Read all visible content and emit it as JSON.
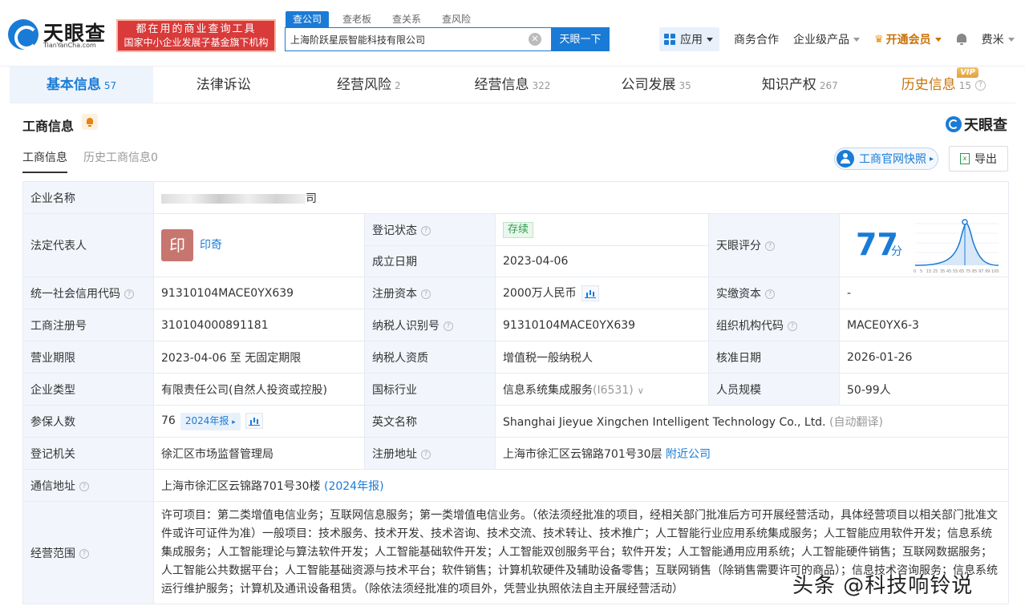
{
  "header": {
    "logo_name": "天眼查",
    "logo_sub": "TianYanCha.com",
    "promo_line1": "都在用的商业查询工具",
    "promo_line2": "国家中小企业发展子基金旗下机构",
    "search_tabs": [
      "查公司",
      "查老板",
      "查关系",
      "查风险"
    ],
    "search_value": "上海阶跃星辰智能科技有限公司",
    "search_button": "天眼一下",
    "nav": {
      "apps": "应用",
      "biz": "商务合作",
      "enterprise": "企业级产品",
      "vip": "开通会员",
      "user": "费米"
    }
  },
  "tabs": [
    {
      "label": "基本信息",
      "count": "57"
    },
    {
      "label": "法律诉讼",
      "count": ""
    },
    {
      "label": "经营风险",
      "count": "2"
    },
    {
      "label": "经营信息",
      "count": "322"
    },
    {
      "label": "公司发展",
      "count": "35"
    },
    {
      "label": "知识产权",
      "count": "267"
    },
    {
      "label": "历史信息",
      "count": "15"
    }
  ],
  "vip_badge": "VIP",
  "section": {
    "title": "工商信息",
    "logo": "天眼查",
    "sub_tabs": [
      "工商信息",
      "历史工商信息0"
    ],
    "snapshot": "工商官网快照",
    "export": "导出"
  },
  "info": {
    "company_name_label": "企业名称",
    "company_name_tail": "司",
    "legal_rep_label": "法定代表人",
    "legal_rep_avatar": "印",
    "legal_rep_name": "印奇",
    "reg_status_label": "登记状态",
    "reg_status": "存续",
    "founded_label": "成立日期",
    "founded": "2023-04-06",
    "score_label": "天眼评分",
    "score": "77",
    "score_unit": "分",
    "score_ticks": [
      "0",
      "5",
      "15",
      "25",
      "35",
      "45",
      "55",
      "65",
      "75",
      "85",
      "97",
      "99",
      "100"
    ],
    "credit_code_label": "统一社会信用代码",
    "credit_code": "91310104MACE0YX639",
    "reg_capital_label": "注册资本",
    "reg_capital": "2000万人民币",
    "paid_capital_label": "实缴资本",
    "paid_capital": "-",
    "reg_no_label": "工商注册号",
    "reg_no": "310104000891181",
    "taxpayer_id_label": "纳税人识别号",
    "taxpayer_id": "91310104MACE0YX639",
    "org_code_label": "组织机构代码",
    "org_code": "MACE0YX6-3",
    "term_label": "营业期限",
    "term": "2023-04-06 至 无固定期限",
    "taxpayer_qual_label": "纳税人资质",
    "taxpayer_qual": "增值税一般纳税人",
    "approve_label": "核准日期",
    "approve": "2026-01-26",
    "type_label": "企业类型",
    "type": "有限责任公司(自然人投资或控股)",
    "industry_label": "国标行业",
    "industry": "信息系统集成服务",
    "industry_code": "(I6531)",
    "staff_label": "人员规模",
    "staff": "50-99人",
    "insured_label": "参保人数",
    "insured": "76",
    "insured_report": "2024年报",
    "english_label": "英文名称",
    "english": "Shanghai Jieyue Xingchen Intelligent Technology Co., Ltd.",
    "english_note": "(自动翻译)",
    "authority_label": "登记机关",
    "authority": "徐汇区市场监督管理局",
    "reg_addr_label": "注册地址",
    "reg_addr": "上海市徐汇区云锦路701号30层",
    "nearby": "附近公司",
    "mail_label": "通信地址",
    "mail_addr": "上海市徐汇区云锦路701号30楼",
    "mail_report": "(2024年报)",
    "scope_label": "经营范围",
    "scope": "许可项目：第二类增值电信业务；互联网信息服务；第一类增值电信业务。（依法须经批准的项目，经相关部门批准后方可开展经营活动，具体经营项目以相关部门批准文件或许可证件为准）一般项目：技术服务、技术开发、技术咨询、技术交流、技术转让、技术推广；人工智能行业应用系统集成服务；人工智能应用软件开发；信息系统集成服务；人工智能理论与算法软件开发；人工智能基础软件开发；人工智能双创服务平台；软件开发；人工智能通用应用系统；人工智能硬件销售；互联网数据服务；人工智能公共数据平台；人工智能基础资源与技术平台；软件销售；计算机软硬件及辅助设备零售；互联网销售（除销售需要许可的商品）；信息技术咨询服务；信息系统运行维护服务；计算机及通讯设备租赁。（除依法须经批准的项目外，凭营业执照依法自主开展经营活动）"
  },
  "watermark": "头条 @科技响铃说",
  "colors": {
    "accent": "#1a7bd6",
    "promo": "#d93a3a",
    "vip": "#c8740a",
    "status_green": "#2f9e4f"
  }
}
